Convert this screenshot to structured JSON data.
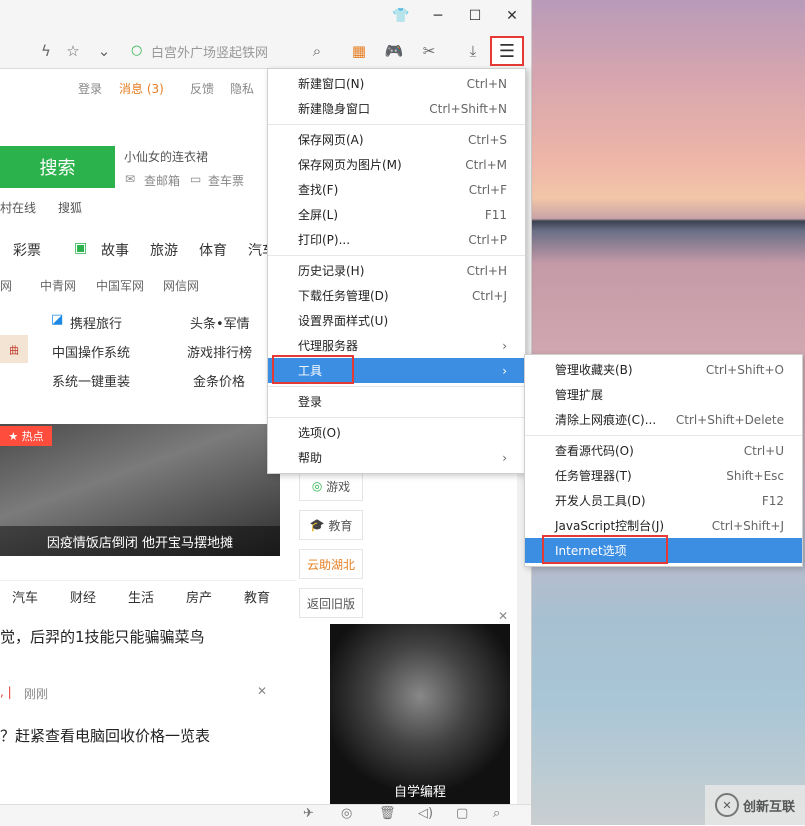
{
  "browser": {
    "address_text": "白宫外广场竖起铁网",
    "top_links": [
      "登录",
      "消息 (3)",
      "反馈",
      "隐私"
    ],
    "search_button": "搜索",
    "suggest_title": "小仙女的连衣裙",
    "suggest_links": [
      "查邮箱",
      "查车票"
    ],
    "row_links": [
      "村在线",
      "搜狐"
    ],
    "nav": [
      "彩票",
      "故事",
      "旅游",
      "体育",
      "汽车"
    ],
    "media_links": [
      "网",
      "中青网",
      "中国军网",
      "网信网"
    ],
    "sites": [
      [
        "携程旅行",
        "头条•军情"
      ],
      [
        "中国操作系统",
        "游戏排行榜"
      ],
      [
        "系统一键重装",
        "金条价格"
      ]
    ],
    "hot_badge": "热点",
    "news_caption": "因疫情饭店倒闭 他开宝马摆地摊",
    "side_buttons": [
      "游戏",
      "教育",
      "云助湖北",
      "返回旧版"
    ],
    "tabs": [
      "汽车",
      "财经",
      "生活",
      "房产",
      "教育"
    ],
    "headline1": "觉，后羿的1技能只能骗骗菜鸟",
    "meta_text": "刚刚",
    "headline2": "？赶紧查看电脑回收价格一览表",
    "ad_caption": "自学编程"
  },
  "main_menu": {
    "groups": [
      [
        {
          "label": "新建窗口(N)",
          "shortcut": "Ctrl+N"
        },
        {
          "label": "新建隐身窗口",
          "shortcut": "Ctrl+Shift+N"
        }
      ],
      [
        {
          "label": "保存网页(A)",
          "shortcut": "Ctrl+S"
        },
        {
          "label": "保存网页为图片(M)",
          "shortcut": "Ctrl+M"
        },
        {
          "label": "查找(F)",
          "shortcut": "Ctrl+F"
        },
        {
          "label": "全屏(L)",
          "shortcut": "F11"
        },
        {
          "label": "打印(P)...",
          "shortcut": "Ctrl+P"
        }
      ],
      [
        {
          "label": "历史记录(H)",
          "shortcut": "Ctrl+H"
        },
        {
          "label": "下载任务管理(D)",
          "shortcut": "Ctrl+J"
        },
        {
          "label": "设置界面样式(U)",
          "shortcut": ""
        },
        {
          "label": "代理服务器",
          "shortcut": "›"
        },
        {
          "label": "工具",
          "shortcut": "›"
        }
      ],
      [
        {
          "label": "登录",
          "shortcut": ""
        }
      ],
      [
        {
          "label": "选项(O)",
          "shortcut": ""
        },
        {
          "label": "帮助",
          "shortcut": "›"
        }
      ]
    ]
  },
  "tools_menu": {
    "groups": [
      [
        {
          "label": "管理收藏夹(B)",
          "shortcut": "Ctrl+Shift+O"
        },
        {
          "label": "管理扩展",
          "shortcut": ""
        },
        {
          "label": "清除上网痕迹(C)...",
          "shortcut": "Ctrl+Shift+Delete"
        }
      ],
      [
        {
          "label": "查看源代码(O)",
          "shortcut": "Ctrl+U"
        },
        {
          "label": "任务管理器(T)",
          "shortcut": "Shift+Esc"
        },
        {
          "label": "开发人员工具(D)",
          "shortcut": "F12"
        },
        {
          "label": "JavaScript控制台(J)",
          "shortcut": "Ctrl+Shift+J"
        },
        {
          "label": "Internet选项",
          "shortcut": ""
        }
      ]
    ]
  },
  "watermark": "创新互联",
  "colors": {
    "accent": "#3c8ee3",
    "highlight_box": "#e53935",
    "search_green": "#2bb24c"
  }
}
